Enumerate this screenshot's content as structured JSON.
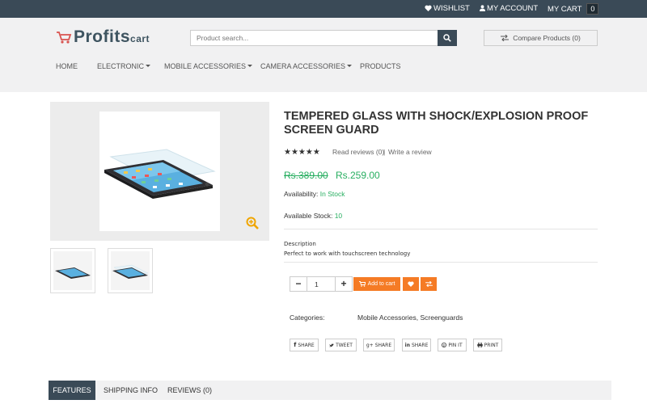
{
  "topbar": {
    "wishlist": "WISHLIST",
    "account": "MY ACCOUNT",
    "cart": "MY CART",
    "cart_count": "0"
  },
  "header": {
    "logo_main": "Profits",
    "logo_sub": "cart",
    "search_placeholder": "Product search...",
    "compare": "Compare Products (0)"
  },
  "nav": {
    "home": "HOME",
    "electronic": "ELECTRONIC",
    "mobile_accessories": "MOBILE ACCESSORIES",
    "camera_accessories": "CAMERA ACCESSORIES",
    "products": "PRODUCTS"
  },
  "product": {
    "title": "TEMPERED GLASS WITH SHOCK/EXPLOSION PROOF SCREEN GUARD",
    "rating_stars": "★★★★★",
    "rating": 5,
    "reviews_link": "Read reviews (0)",
    "reviews_sep": "|",
    "write_review": "Write a review",
    "price_old": "Rs.389.00",
    "price_new": "Rs.259.00",
    "availability_label": "Availability:",
    "availability_value": "In Stock",
    "stock_label": "Available Stock:",
    "stock_value": "10",
    "description_label": "Description",
    "description_text": "Perfect to work with touchscreen technology"
  },
  "cart_controls": {
    "minus": "−",
    "quantity": "1",
    "plus": "+",
    "add_to_cart": "Add to cart"
  },
  "categories": {
    "label": "Categories:",
    "value": "Mobile Accessories, Screenguards"
  },
  "share": {
    "facebook": "SHARE",
    "twitter": "TWEET",
    "gplus": "SHARE",
    "linkedin": "SHARE",
    "pinterest": "PIN IT",
    "print": "PRINT"
  },
  "tabs": {
    "features": "FEATURES",
    "shipping": "SHIPPING INFO",
    "reviews": "REVIEWS (0)"
  },
  "colors": {
    "topbar": "#3a4a57",
    "accent_orange": "#f57b25",
    "price_green": "#27ae60",
    "header_bg": "#f1f1f2"
  },
  "icons": [
    "heart-icon",
    "user-icon",
    "shopping-cart-icon",
    "search-icon",
    "compare-arrows-icon",
    "zoom-icon",
    "facebook-icon",
    "twitter-icon",
    "google-plus-icon",
    "linkedin-icon",
    "pinterest-icon",
    "print-icon"
  ]
}
